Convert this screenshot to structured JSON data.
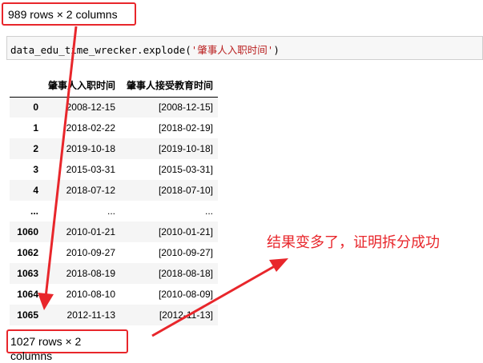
{
  "summary_top": "989 rows × 2 columns",
  "summary_bottom": "1027 rows × 2 columns",
  "code": {
    "prefix": "data_edu_time_wrecker.explode(",
    "arg": "'肇事人入职时间'",
    "suffix": ")"
  },
  "table": {
    "columns": [
      "",
      "肇事人入职时间",
      "肇事人接受教育时间"
    ],
    "rows": [
      {
        "index": "0",
        "hire": "2008-12-15",
        "edu": "[2008-12-15]"
      },
      {
        "index": "1",
        "hire": "2018-02-22",
        "edu": "[2018-02-19]"
      },
      {
        "index": "2",
        "hire": "2019-10-18",
        "edu": "[2019-10-18]"
      },
      {
        "index": "3",
        "hire": "2015-03-31",
        "edu": "[2015-03-31]"
      },
      {
        "index": "4",
        "hire": "2018-07-12",
        "edu": "[2018-07-10]"
      },
      {
        "index": "...",
        "hire": "...",
        "edu": "..."
      },
      {
        "index": "1060",
        "hire": "2010-01-21",
        "edu": "[2010-01-21]"
      },
      {
        "index": "1062",
        "hire": "2010-09-27",
        "edu": "[2010-09-27]"
      },
      {
        "index": "1063",
        "hire": "2018-08-19",
        "edu": "[2018-08-18]"
      },
      {
        "index": "1064",
        "hire": "2010-08-10",
        "edu": "[2010-08-09]"
      },
      {
        "index": "1065",
        "hire": "2012-11-13",
        "edu": "[2012-11-13]"
      }
    ]
  },
  "annotation": "结果变多了，证明拆分成功",
  "annotation_color": "#e8262b"
}
